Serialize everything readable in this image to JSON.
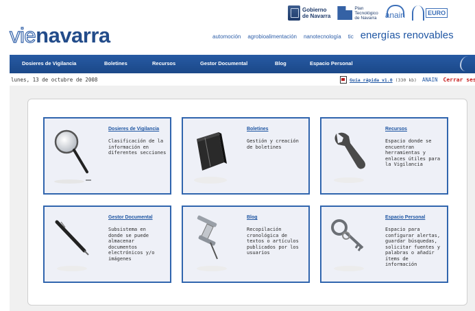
{
  "logos": {
    "gobierno": [
      "Gobierno",
      "de Navarra"
    ],
    "plan": [
      "Plan",
      "Tecnológico",
      "de Navarra"
    ],
    "anain": "anain",
    "euro": "EURO"
  },
  "brand": {
    "part1": "vie",
    "part2": "navarra"
  },
  "topics": [
    "automoción",
    "agrobioalimentación",
    "nanotecnología",
    "tic",
    "energías renovables"
  ],
  "nav": [
    "Dosieres de Vigilancia",
    "Boletines",
    "Recursos",
    "Gestor Documental",
    "Blog",
    "Espacio Personal"
  ],
  "date": "lunes, 13 de octubre de 2008",
  "links": {
    "guide": "Guía rápida v1.0",
    "guide_size": "(330 kb)",
    "anain": "ANAIN",
    "logout": "Cerrar ses"
  },
  "cards": [
    {
      "title": "Dosieres de Vigilancia",
      "desc": [
        "Clasificación de la",
        "información en",
        "diferentes secciones"
      ],
      "icon": "magnifier-icon"
    },
    {
      "title": "Boletines",
      "desc": [
        "Gestión y creación",
        "de boletines"
      ],
      "icon": "notebook-icon"
    },
    {
      "title": "Recursos",
      "desc": [
        "Espacio donde se",
        "encuentran",
        "herramientas y",
        "enlaces útiles para",
        "la Vigilancia"
      ],
      "icon": "wrench-icon"
    },
    {
      "title": "Gestor Documental",
      "desc": [
        "Subsistema en",
        "donde se puede",
        "almacenar",
        "documentos",
        "electrónicos y/o",
        "imágenes"
      ],
      "icon": "pen-icon"
    },
    {
      "title": "Blog",
      "desc": [
        "Recopilación",
        "cronológica de",
        "textos o artículos",
        "publicados por los",
        "usuarios"
      ],
      "icon": "pushpin-icon"
    },
    {
      "title": "Espacio Personal",
      "desc": [
        "Espacio para",
        "configurar alertas,",
        "guardar búsquedas,",
        "solicitar fuentes y",
        "palabras o añadir",
        "ítems de",
        "información"
      ],
      "icon": "keys-icon"
    }
  ]
}
